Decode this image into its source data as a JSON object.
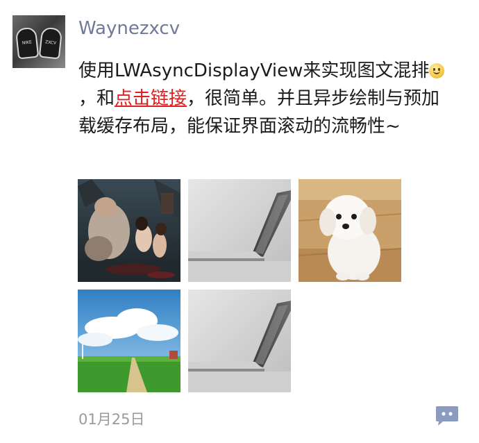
{
  "post": {
    "author": "Waynezxcv",
    "text_part1": "使用LWAsyncDisplayView来实现图文混排",
    "text_part2": "，和",
    "link_text": "点击链接",
    "text_part3": "，很简单。并且异步绘制与预加载缓存布局，能保证界面滚动的流畅性~",
    "date": "01月25日"
  },
  "avatar": {
    "lettering_left": "NIKE",
    "lettering_right": "ZXCV"
  },
  "icons": {
    "emoji": "smiley-face-icon",
    "comment": "comment-bubble-icon"
  },
  "colors": {
    "author": "#6f7a99",
    "link": "#e02020",
    "comment_button": "#8a9bbf",
    "date": "#9a9a9a"
  }
}
